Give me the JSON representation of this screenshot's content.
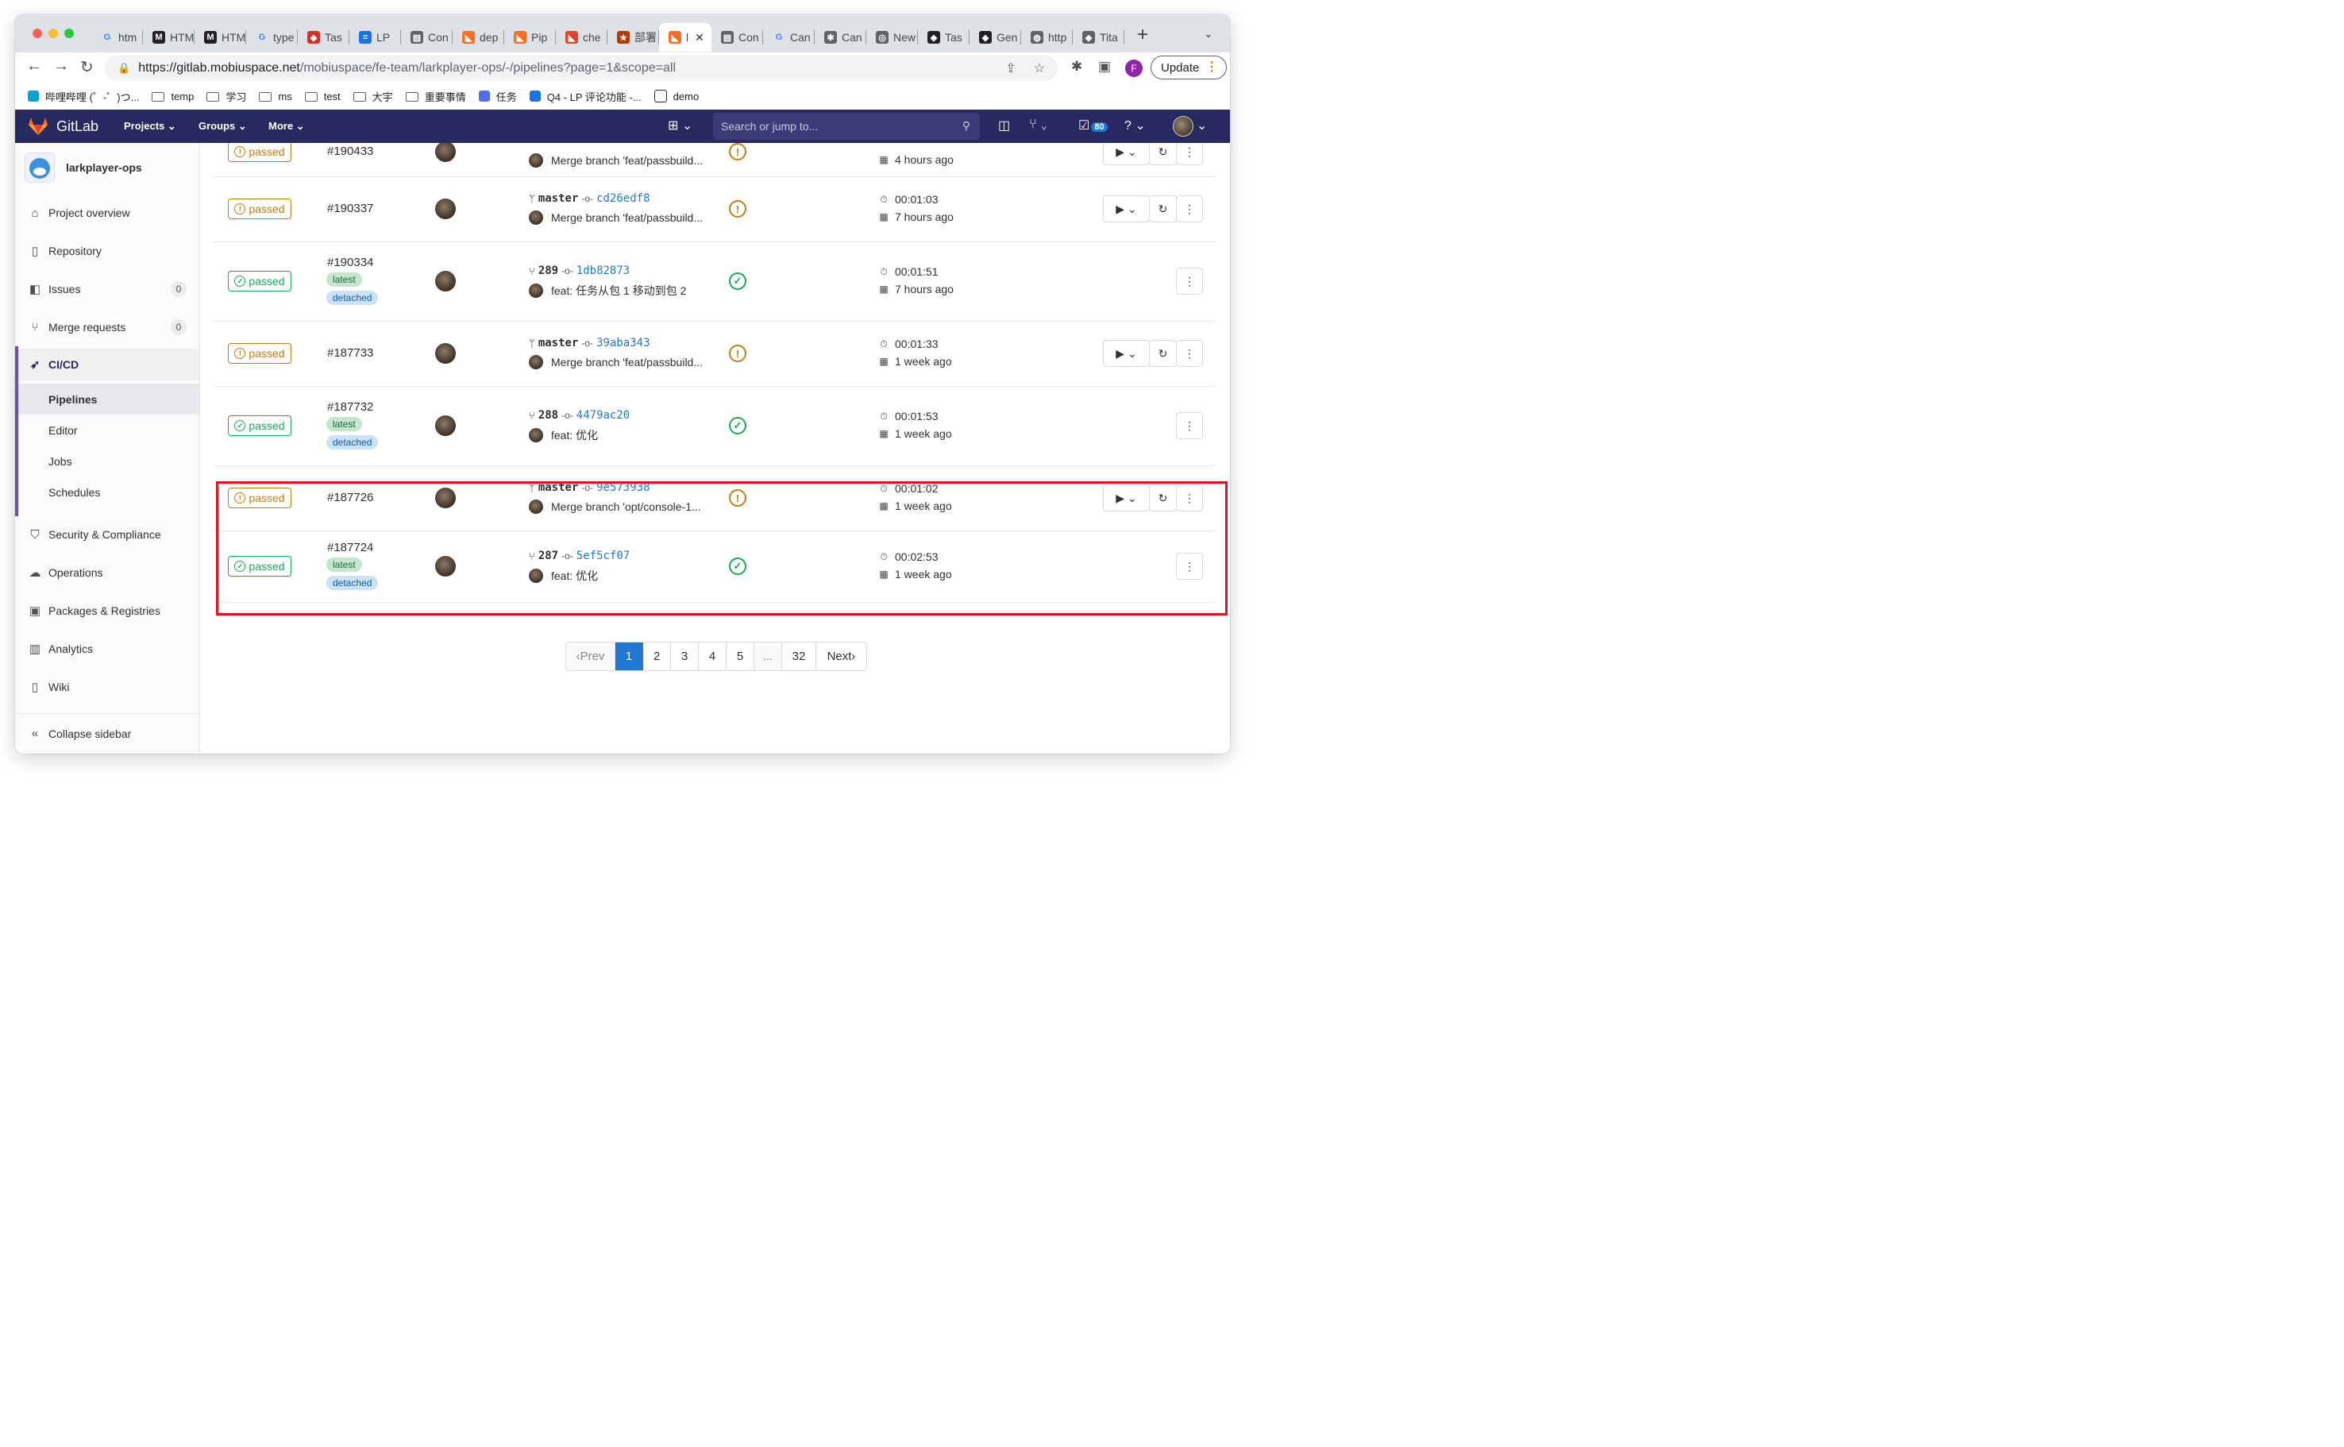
{
  "browser": {
    "tabs": [
      {
        "title": "htm",
        "icon": "google-icon",
        "color": "#4285f4"
      },
      {
        "title": "HTM",
        "icon": "m-logo-icon",
        "color": "#202124"
      },
      {
        "title": "HTM",
        "icon": "m-logo-icon",
        "color": "#202124"
      },
      {
        "title": "type",
        "icon": "google-icon",
        "color": "#4285f4"
      },
      {
        "title": "Tas",
        "icon": "app-icon",
        "color": "#d93025"
      },
      {
        "title": "LP",
        "icon": "doc-icon",
        "color": "#1a73e8"
      },
      {
        "title": "Con",
        "icon": "page-icon",
        "color": "#5f6368"
      },
      {
        "title": "dep",
        "icon": "gitlab-icon",
        "color": "#fc6d26"
      },
      {
        "title": "Pip",
        "icon": "gitlab-icon",
        "color": "#fc6d26"
      },
      {
        "title": "che",
        "icon": "gitlab-icon",
        "color": "#e24329"
      },
      {
        "title": "部署",
        "icon": "star-icon",
        "color": "#b33a00"
      },
      {
        "title": "l",
        "icon": "gitlab-icon",
        "color": "#fc6d26",
        "active": true
      },
      {
        "title": "Con",
        "icon": "page-icon",
        "color": "#5f6368"
      },
      {
        "title": "Can",
        "icon": "google-icon",
        "color": "#4285f4"
      },
      {
        "title": "Can",
        "icon": "puzzle-icon",
        "color": "#5f6368"
      },
      {
        "title": "New",
        "icon": "chrome-icon",
        "color": "#5f6368"
      },
      {
        "title": "Tas",
        "icon": "app-icon",
        "color": "#202124"
      },
      {
        "title": "Gen",
        "icon": "app-icon",
        "color": "#202124"
      },
      {
        "title": "http",
        "icon": "globe-icon",
        "color": "#5f6368"
      },
      {
        "title": "Tita",
        "icon": "app-icon",
        "color": "#5f6368"
      }
    ],
    "url_host": "https://gitlab.mobiuspace.net",
    "url_path": "/mobiuspace/fe-team/larkplayer-ops/-/pipelines?page=1&scope=all",
    "profile_initial": "F",
    "update_label": "Update",
    "bookmarks": [
      {
        "label": "哔哩哔哩 (゜-゜)つ...",
        "icon": "tv-icon"
      },
      {
        "label": "temp",
        "icon": "folder-icon"
      },
      {
        "label": "学习",
        "icon": "folder-icon"
      },
      {
        "label": "ms",
        "icon": "folder-icon"
      },
      {
        "label": "test",
        "icon": "folder-icon"
      },
      {
        "label": "大宇",
        "icon": "folder-icon"
      },
      {
        "label": "重要事情",
        "icon": "folder-icon"
      },
      {
        "label": "任务",
        "icon": "app-icon"
      },
      {
        "label": "Q4 - LP 评论功能 -...",
        "icon": "doc-icon"
      },
      {
        "label": "demo",
        "icon": "page-icon"
      }
    ]
  },
  "header": {
    "brand": "GitLab",
    "nav": [
      "Projects",
      "Groups",
      "More"
    ],
    "search_placeholder": "Search or jump to...",
    "todo_count": "80"
  },
  "sidebar": {
    "project": "larkplayer-ops",
    "items": [
      {
        "label": "Project overview",
        "icon": "home-icon"
      },
      {
        "label": "Repository",
        "icon": "doc-icon"
      },
      {
        "label": "Issues",
        "icon": "issues-icon",
        "count": "0"
      },
      {
        "label": "Merge requests",
        "icon": "merge-request-icon",
        "count": "0"
      },
      {
        "label": "CI/CD",
        "icon": "rocket-icon"
      },
      {
        "label": "Security & Compliance",
        "icon": "shield-icon"
      },
      {
        "label": "Operations",
        "icon": "cloud-icon"
      },
      {
        "label": "Packages & Registries",
        "icon": "package-icon"
      },
      {
        "label": "Analytics",
        "icon": "chart-icon"
      },
      {
        "label": "Wiki",
        "icon": "book-icon"
      }
    ],
    "cicd_sub": [
      "Pipelines",
      "Editor",
      "Jobs",
      "Schedules"
    ],
    "collapse_label": "Collapse sidebar"
  },
  "pipelines": [
    {
      "status": "passed",
      "kind": "warn",
      "id": "#190433",
      "ref_type": "branch",
      "ref": "",
      "sha": "",
      "message": "Merge branch 'feat/passbuild...",
      "stage": "warn",
      "duration": "",
      "finished": "4 hours ago",
      "tags": []
    },
    {
      "status": "passed",
      "kind": "warn",
      "id": "#190337",
      "ref_type": "branch",
      "ref": "master",
      "sha": "cd26edf8",
      "message": "Merge branch 'feat/passbuild...",
      "stage": "warn",
      "duration": "00:01:03",
      "finished": "7 hours ago",
      "tags": []
    },
    {
      "status": "passed",
      "kind": "ok",
      "id": "#190334",
      "ref_type": "mr",
      "ref": "289",
      "sha": "1db82873",
      "message": "feat: 任务从包 1 移动到包 2",
      "stage": "ok",
      "duration": "00:01:51",
      "finished": "7 hours ago",
      "tags": [
        "latest",
        "detached"
      ]
    },
    {
      "status": "passed",
      "kind": "warn",
      "id": "#187733",
      "ref_type": "branch",
      "ref": "master",
      "sha": "39aba343",
      "message": "Merge branch 'feat/passbuild...",
      "stage": "warn",
      "duration": "00:01:33",
      "finished": "1 week ago",
      "tags": []
    },
    {
      "status": "passed",
      "kind": "ok",
      "id": "#187732",
      "ref_type": "mr",
      "ref": "288",
      "sha": "4479ac20",
      "message": "feat: 优化",
      "stage": "ok",
      "duration": "00:01:53",
      "finished": "1 week ago",
      "tags": [
        "latest",
        "detached"
      ]
    },
    {
      "status": "passed",
      "kind": "warn",
      "id": "#187726",
      "ref_type": "branch",
      "ref": "master",
      "sha": "9e573938",
      "message": "Merge branch 'opt/console-1...",
      "stage": "warn",
      "duration": "00:01:02",
      "finished": "1 week ago",
      "tags": []
    },
    {
      "status": "passed",
      "kind": "ok",
      "id": "#187724",
      "ref_type": "mr",
      "ref": "287",
      "sha": "5ef5cf07",
      "message": "feat: 优化",
      "stage": "ok",
      "duration": "00:02:53",
      "finished": "1 week ago",
      "tags": [
        "latest",
        "detached"
      ]
    }
  ],
  "pagination": {
    "prev": "Prev",
    "pages": [
      "1",
      "2",
      "3",
      "4",
      "5",
      "...",
      "32"
    ],
    "current": "1",
    "next": "Next"
  }
}
